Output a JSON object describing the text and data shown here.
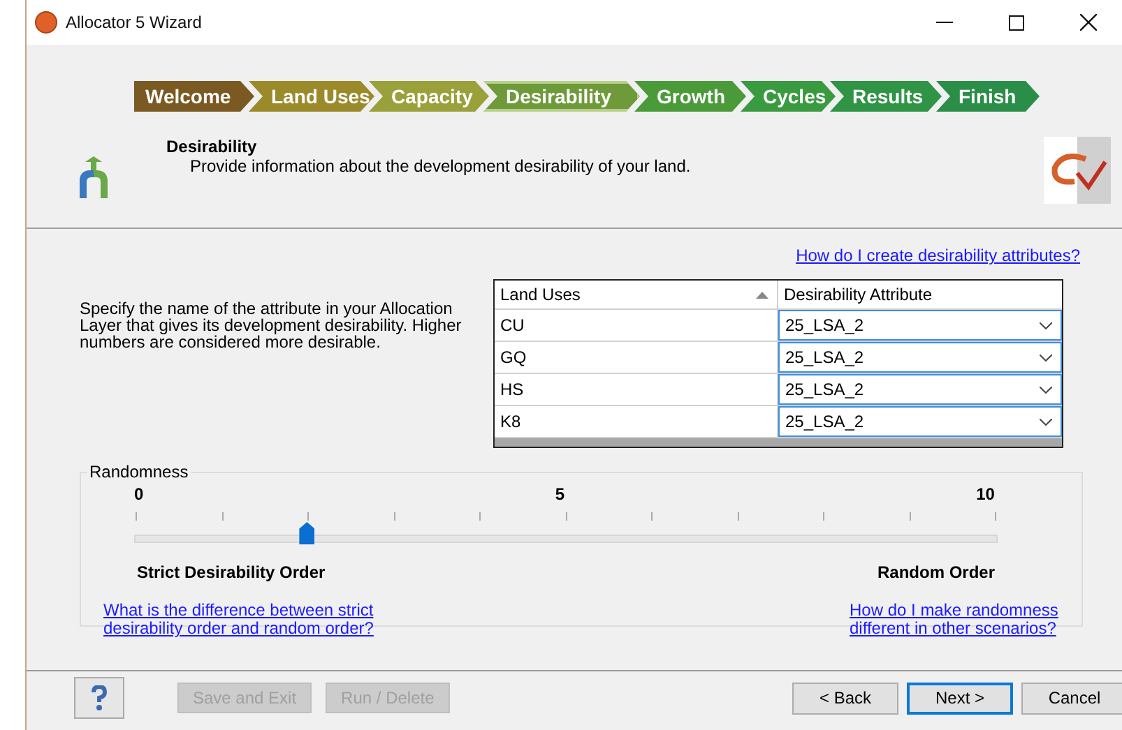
{
  "window": {
    "title": "Allocator 5 Wizard"
  },
  "steps": [
    {
      "label": "Welcome",
      "selected": false,
      "color": "#7a5a22"
    },
    {
      "label": "Land Uses",
      "selected": false,
      "color": "#9a8a2a"
    },
    {
      "label": "Capacity",
      "selected": false,
      "color": "#9aa03a"
    },
    {
      "label": "Desirability",
      "selected": true,
      "color": "#6e9a3a"
    },
    {
      "label": "Growth",
      "selected": false,
      "color": "#4a9a3a"
    },
    {
      "label": "Cycles",
      "selected": false,
      "color": "#3a9a40"
    },
    {
      "label": "Results",
      "selected": false,
      "color": "#2f9445"
    },
    {
      "label": "Finish",
      "selected": false,
      "color": "#2a8e48"
    }
  ],
  "header": {
    "title": "Desirability",
    "subtitle": "Provide information about the development desirability of your land."
  },
  "help_link_top": "How do I create desirability attributes?",
  "instructions": "Specify the name of the attribute in your Allocation Layer that gives its development desirability.  Higher numbers are considered more desirable.",
  "table": {
    "columns": [
      "Land Uses",
      "Desirability Attribute"
    ],
    "rows": [
      {
        "land_use": "CU",
        "attribute": "25_LSA_2"
      },
      {
        "land_use": "GQ",
        "attribute": "25_LSA_2"
      },
      {
        "land_use": "HS",
        "attribute": "25_LSA_2"
      },
      {
        "land_use": "K8",
        "attribute": "25_LSA_2"
      }
    ]
  },
  "randomness": {
    "legend": "Randomness",
    "scale": [
      "0",
      "5",
      "10"
    ],
    "level": 0.2,
    "left_label": "Strict Desirability Order",
    "right_label": "Random Order",
    "left_link": "What is the difference between strict desirability order and random order?",
    "right_link": "How do I make randomness different in other scenarios?"
  },
  "buttons": [
    {
      "label": "Save and Exit",
      "disabled": true
    },
    {
      "label": "Run / Delete",
      "disabled": true
    }
  ],
  "nav_buttons": [
    {
      "label": "< Back",
      "default": false
    },
    {
      "label": "Next >",
      "default": true
    },
    {
      "label": "Cancel",
      "default": false
    }
  ]
}
